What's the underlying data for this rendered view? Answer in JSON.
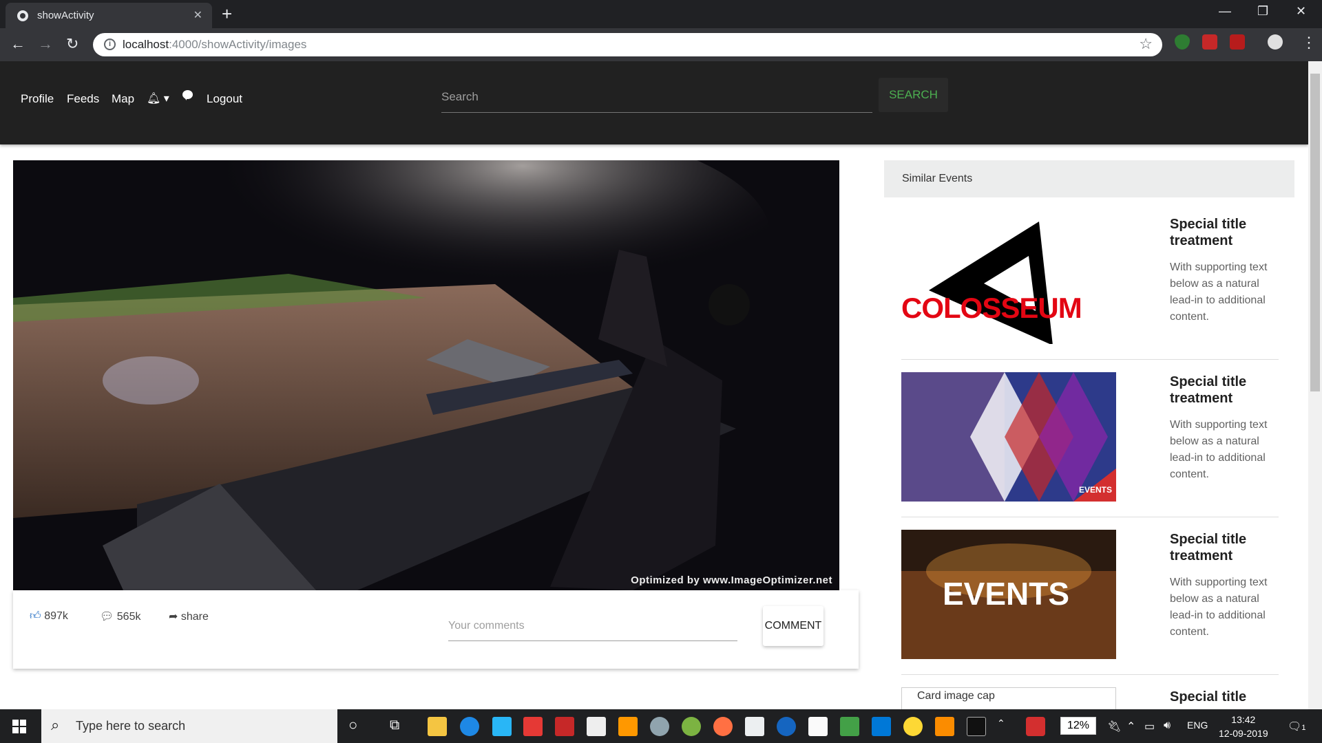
{
  "browser": {
    "tab_title": "showActivity",
    "url_host": "localhost",
    "url_path": ":4000/showActivity/images"
  },
  "appnav": {
    "links": [
      "Profile",
      "Feeds",
      "Map",
      "Logout"
    ],
    "search_placeholder": "Search",
    "search_button": "SEARCH"
  },
  "post": {
    "watermark": "Optimized by www.ImageOptimizer.net",
    "likes": "897k",
    "comments": "565k",
    "share": "share",
    "comment_placeholder": "Your comments",
    "comment_button": "COMMENT"
  },
  "similar": {
    "heading": "Similar Events",
    "cards": [
      {
        "title": "Special title treatment",
        "text": "With supporting text below as a natural lead-in to additional content.",
        "image_text": "COLOSSEUM"
      },
      {
        "title": "Special title treatment",
        "text": "With supporting text below as a natural lead-in to additional content.",
        "image_text": "EVENTS"
      },
      {
        "title": "Special title treatment",
        "text": "With supporting text below as a natural lead-in to additional content.",
        "image_text": "EVENTS"
      },
      {
        "title": "Special title",
        "image_alt": "Card image cap"
      }
    ]
  },
  "taskbar": {
    "search_placeholder": "Type here to search",
    "battery": "12%",
    "language": "ENG",
    "time": "13:42",
    "date": "12-09-2019",
    "notifications": "1"
  }
}
